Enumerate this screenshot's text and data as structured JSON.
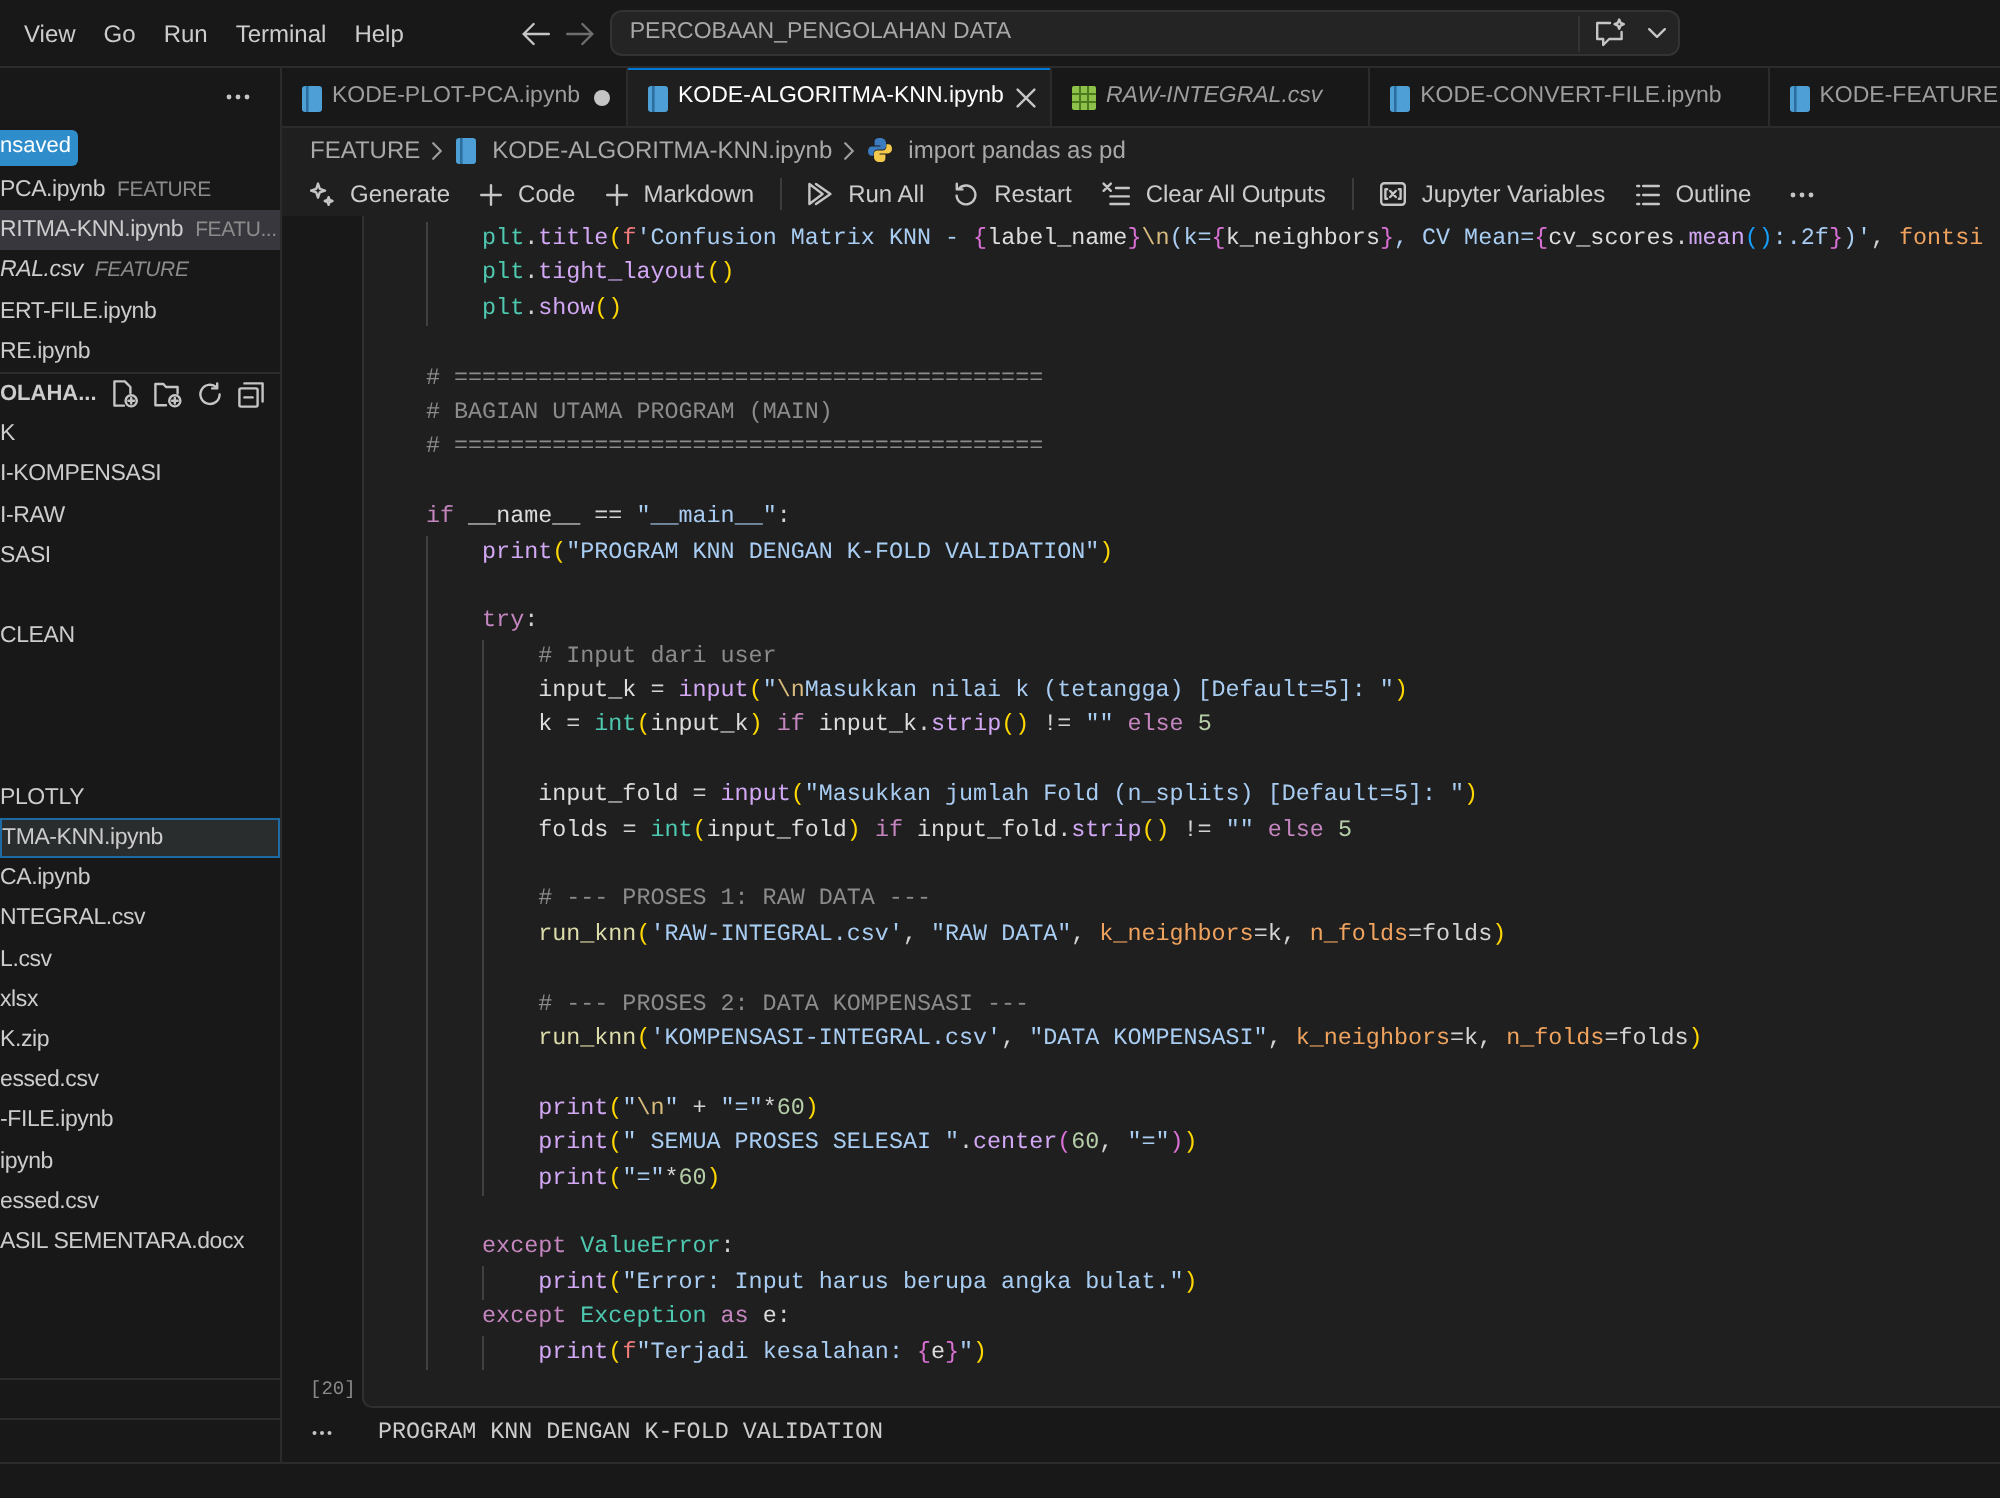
{
  "menu_bar": [
    "View",
    "Go",
    "Run",
    "Terminal",
    "Help"
  ],
  "command_center": {
    "text": "PERCOBAAN_PENGOLAHAN DATA"
  },
  "sidebar": {
    "unsaved_badge": "nsaved",
    "open_editors": [
      {
        "name": "PCA.ipynb",
        "description": "FEATURE",
        "selected": false,
        "preview": false
      },
      {
        "name": "RITMA-KNN.ipynb",
        "description": "FEATU...",
        "selected": true,
        "preview": false
      },
      {
        "name": "RAL.csv",
        "description": "FEATURE",
        "selected": false,
        "preview": true
      },
      {
        "name": "ERT-FILE.ipynb",
        "selected": false,
        "preview": false
      },
      {
        "name": "RE.ipynb",
        "selected": false,
        "preview": false
      }
    ],
    "explorer_title": "OLAHA...",
    "tree": [
      {
        "label": "K",
        "selected": false
      },
      {
        "label": "I-KOMPENSASI",
        "selected": false
      },
      {
        "label": "I-RAW",
        "selected": false
      },
      {
        "label": "SASI",
        "selected": false
      },
      {
        "label": "CLEAN",
        "selected": false
      },
      {
        "label": "PLOTLY",
        "selected": false
      },
      {
        "label": "TMA-KNN.ipynb",
        "selected": true
      },
      {
        "label": "CA.ipynb",
        "selected": false
      },
      {
        "label": "NTEGRAL.csv",
        "selected": false
      },
      {
        "label": "L.csv",
        "selected": false
      },
      {
        "label": "xlsx",
        "selected": false
      },
      {
        "label": "K.zip",
        "selected": false
      },
      {
        "label": "essed.csv",
        "selected": false
      },
      {
        "label": "-FILE.ipynb",
        "selected": false
      },
      {
        "label": "ipynb",
        "selected": false
      },
      {
        "label": "essed.csv",
        "selected": false
      },
      {
        "label": "ASIL SEMENTARA.docx",
        "selected": false
      }
    ]
  },
  "tabs": [
    {
      "label": "KODE-PLOT-PCA.ipynb",
      "kind": "notebook",
      "selected": false,
      "modified": true,
      "preview": false
    },
    {
      "label": "KODE-ALGORITMA-KNN.ipynb",
      "kind": "notebook",
      "selected": true,
      "modified": false,
      "preview": false
    },
    {
      "label": "RAW-INTEGRAL.csv",
      "kind": "csv",
      "selected": false,
      "modified": false,
      "preview": true
    },
    {
      "label": "KODE-CONVERT-FILE.ipynb",
      "kind": "notebook",
      "selected": false,
      "modified": false,
      "preview": false
    },
    {
      "label": "KODE-FEATURE",
      "kind": "notebook",
      "selected": false,
      "modified": false,
      "preview": false
    }
  ],
  "breadcrumb": [
    {
      "kind": "folder",
      "label": "FEATURE"
    },
    {
      "kind": "notebook",
      "label": "KODE-ALGORITMA-KNN.ipynb"
    },
    {
      "kind": "python",
      "label": "import pandas as pd"
    }
  ],
  "toolbar": {
    "groups": [
      [
        "Generate",
        "Code",
        "Markdown"
      ],
      [
        "Run All",
        "Restart",
        "Clear All Outputs"
      ],
      [
        "Jupyter Variables",
        "Outline"
      ]
    ]
  },
  "cell": {
    "execution_count": "[20]",
    "lines": [
      {
        "kind": "group",
        "children": [
          {
            "kind": "code",
            "tokens": [
              {
                "kind": "cls",
                "text": "plt"
              },
              {
                "kind": "op",
                "text": "."
              },
              {
                "kind": "fn",
                "text": "title"
              },
              {
                "kind": "br1",
                "text": "("
              },
              {
                "kind": "fpre",
                "text": "f"
              },
              {
                "kind": "str",
                "text": "'Confusion Matrix KNN - "
              },
              {
                "kind": "br2",
                "text": "{"
              },
              {
                "kind": "var",
                "text": "label_name"
              },
              {
                "kind": "br2",
                "text": "}"
              },
              {
                "kind": "esc",
                "text": "\\n"
              },
              {
                "kind": "str",
                "text": "(k="
              },
              {
                "kind": "br2",
                "text": "{"
              },
              {
                "kind": "var",
                "text": "k_neighbors"
              },
              {
                "kind": "br2",
                "text": "}"
              },
              {
                "kind": "str",
                "text": ", CV Mean="
              },
              {
                "kind": "br2",
                "text": "{"
              },
              {
                "kind": "var",
                "text": "cv_scores"
              },
              {
                "kind": "op",
                "text": "."
              },
              {
                "kind": "fn",
                "text": "mean"
              },
              {
                "kind": "br3",
                "text": "()"
              },
              {
                "kind": "str",
                "text": ":.2f"
              },
              {
                "kind": "br2",
                "text": "}"
              },
              {
                "kind": "str",
                "text": ")'"
              },
              {
                "kind": "op",
                "text": ", "
              },
              {
                "kind": "param",
                "text": "fontsi"
              }
            ]
          },
          {
            "kind": "code",
            "tokens": [
              {
                "kind": "cls",
                "text": "plt"
              },
              {
                "kind": "op",
                "text": "."
              },
              {
                "kind": "fn",
                "text": "tight_layout"
              },
              {
                "kind": "br1",
                "text": "()"
              }
            ]
          },
          {
            "kind": "code",
            "tokens": [
              {
                "kind": "cls",
                "text": "plt"
              },
              {
                "kind": "op",
                "text": "."
              },
              {
                "kind": "fn",
                "text": "show"
              },
              {
                "kind": "br1",
                "text": "()"
              }
            ]
          }
        ]
      },
      {
        "kind": "blank"
      },
      {
        "kind": "code",
        "tokens": [
          {
            "kind": "cmt",
            "text": "# =========================================="
          }
        ]
      },
      {
        "kind": "code",
        "tokens": [
          {
            "kind": "cmt",
            "text": "# BAGIAN UTAMA PROGRAM (MAIN)"
          }
        ]
      },
      {
        "kind": "code",
        "tokens": [
          {
            "kind": "cmt",
            "text": "# =========================================="
          }
        ]
      },
      {
        "kind": "blank"
      },
      {
        "kind": "code",
        "tokens": [
          {
            "kind": "kw",
            "text": "if"
          },
          {
            "kind": "var",
            "text": " __name__ "
          },
          {
            "kind": "op",
            "text": "== "
          },
          {
            "kind": "str",
            "text": "\"__main__\""
          },
          {
            "kind": "op",
            "text": ":"
          }
        ],
        "children": [
          {
            "kind": "code",
            "tokens": [
              {
                "kind": "fn",
                "text": "print"
              },
              {
                "kind": "br1",
                "text": "("
              },
              {
                "kind": "str",
                "text": "\"PROGRAM KNN DENGAN K-FOLD VALIDATION\""
              },
              {
                "kind": "br1",
                "text": ")"
              }
            ]
          },
          {
            "kind": "blank"
          },
          {
            "kind": "code",
            "tokens": [
              {
                "kind": "kw",
                "text": "try"
              },
              {
                "kind": "op",
                "text": ":"
              }
            ],
            "children": [
              {
                "kind": "code",
                "tokens": [
                  {
                    "kind": "cmt",
                    "text": "# Input dari user"
                  }
                ]
              },
              {
                "kind": "code",
                "tokens": [
                  {
                    "kind": "var",
                    "text": "input_k "
                  },
                  {
                    "kind": "op",
                    "text": "= "
                  },
                  {
                    "kind": "fn",
                    "text": "input"
                  },
                  {
                    "kind": "br1",
                    "text": "("
                  },
                  {
                    "kind": "str",
                    "text": "\""
                  },
                  {
                    "kind": "esc",
                    "text": "\\n"
                  },
                  {
                    "kind": "str",
                    "text": "Masukkan nilai k (tetangga) [Default=5]: \""
                  },
                  {
                    "kind": "br1",
                    "text": ")"
                  }
                ]
              },
              {
                "kind": "code",
                "tokens": [
                  {
                    "kind": "var",
                    "text": "k "
                  },
                  {
                    "kind": "op",
                    "text": "= "
                  },
                  {
                    "kind": "cls",
                    "text": "int"
                  },
                  {
                    "kind": "br1",
                    "text": "("
                  },
                  {
                    "kind": "var",
                    "text": "input_k"
                  },
                  {
                    "kind": "br1",
                    "text": ")"
                  },
                  {
                    "kind": "kw",
                    "text": " if "
                  },
                  {
                    "kind": "var",
                    "text": "input_k"
                  },
                  {
                    "kind": "op",
                    "text": "."
                  },
                  {
                    "kind": "fn",
                    "text": "strip"
                  },
                  {
                    "kind": "br1",
                    "text": "()"
                  },
                  {
                    "kind": "op",
                    "text": " != "
                  },
                  {
                    "kind": "str",
                    "text": "\"\""
                  },
                  {
                    "kind": "kw",
                    "text": " else "
                  },
                  {
                    "kind": "num",
                    "text": "5"
                  }
                ]
              },
              {
                "kind": "blank"
              },
              {
                "kind": "code",
                "tokens": [
                  {
                    "kind": "var",
                    "text": "input_fold "
                  },
                  {
                    "kind": "op",
                    "text": "= "
                  },
                  {
                    "kind": "fn",
                    "text": "input"
                  },
                  {
                    "kind": "br1",
                    "text": "("
                  },
                  {
                    "kind": "str",
                    "text": "\"Masukkan jumlah Fold (n_splits) [Default=5]: \""
                  },
                  {
                    "kind": "br1",
                    "text": ")"
                  }
                ]
              },
              {
                "kind": "code",
                "tokens": [
                  {
                    "kind": "var",
                    "text": "folds "
                  },
                  {
                    "kind": "op",
                    "text": "= "
                  },
                  {
                    "kind": "cls",
                    "text": "int"
                  },
                  {
                    "kind": "br1",
                    "text": "("
                  },
                  {
                    "kind": "var",
                    "text": "input_fold"
                  },
                  {
                    "kind": "br1",
                    "text": ")"
                  },
                  {
                    "kind": "kw",
                    "text": " if "
                  },
                  {
                    "kind": "var",
                    "text": "input_fold"
                  },
                  {
                    "kind": "op",
                    "text": "."
                  },
                  {
                    "kind": "fn",
                    "text": "strip"
                  },
                  {
                    "kind": "br1",
                    "text": "()"
                  },
                  {
                    "kind": "op",
                    "text": " != "
                  },
                  {
                    "kind": "str",
                    "text": "\"\""
                  },
                  {
                    "kind": "kw",
                    "text": " else "
                  },
                  {
                    "kind": "num",
                    "text": "5"
                  }
                ]
              },
              {
                "kind": "blank"
              },
              {
                "kind": "code",
                "tokens": [
                  {
                    "kind": "cmt",
                    "text": "# --- PROSES 1: RAW DATA ---"
                  }
                ]
              },
              {
                "kind": "code",
                "tokens": [
                  {
                    "kind": "ufn",
                    "text": "run_knn"
                  },
                  {
                    "kind": "br1",
                    "text": "("
                  },
                  {
                    "kind": "str",
                    "text": "'RAW-INTEGRAL.csv'"
                  },
                  {
                    "kind": "op",
                    "text": ", "
                  },
                  {
                    "kind": "str",
                    "text": "\"RAW DATA\""
                  },
                  {
                    "kind": "op",
                    "text": ", "
                  },
                  {
                    "kind": "param",
                    "text": "k_neighbors"
                  },
                  {
                    "kind": "op",
                    "text": "=k, "
                  },
                  {
                    "kind": "param",
                    "text": "n_folds"
                  },
                  {
                    "kind": "op",
                    "text": "=folds"
                  },
                  {
                    "kind": "br1",
                    "text": ")"
                  }
                ]
              },
              {
                "kind": "blank"
              },
              {
                "kind": "code",
                "tokens": [
                  {
                    "kind": "cmt",
                    "text": "# --- PROSES 2: DATA KOMPENSASI ---"
                  }
                ]
              },
              {
                "kind": "code",
                "tokens": [
                  {
                    "kind": "ufn",
                    "text": "run_knn"
                  },
                  {
                    "kind": "br1",
                    "text": "("
                  },
                  {
                    "kind": "str",
                    "text": "'KOMPENSASI-INTEGRAL.csv'"
                  },
                  {
                    "kind": "op",
                    "text": ", "
                  },
                  {
                    "kind": "str",
                    "text": "\"DATA KOMPENSASI\""
                  },
                  {
                    "kind": "op",
                    "text": ", "
                  },
                  {
                    "kind": "param",
                    "text": "k_neighbors"
                  },
                  {
                    "kind": "op",
                    "text": "=k, "
                  },
                  {
                    "kind": "param",
                    "text": "n_folds"
                  },
                  {
                    "kind": "op",
                    "text": "=folds"
                  },
                  {
                    "kind": "br1",
                    "text": ")"
                  }
                ]
              },
              {
                "kind": "blank"
              },
              {
                "kind": "code",
                "tokens": [
                  {
                    "kind": "fn",
                    "text": "print"
                  },
                  {
                    "kind": "br1",
                    "text": "("
                  },
                  {
                    "kind": "str",
                    "text": "\""
                  },
                  {
                    "kind": "esc",
                    "text": "\\n"
                  },
                  {
                    "kind": "str",
                    "text": "\""
                  },
                  {
                    "kind": "op",
                    "text": " + "
                  },
                  {
                    "kind": "str",
                    "text": "\"=\""
                  },
                  {
                    "kind": "op",
                    "text": "*"
                  },
                  {
                    "kind": "num",
                    "text": "60"
                  },
                  {
                    "kind": "br1",
                    "text": ")"
                  }
                ]
              },
              {
                "kind": "code",
                "tokens": [
                  {
                    "kind": "fn",
                    "text": "print"
                  },
                  {
                    "kind": "br1",
                    "text": "("
                  },
                  {
                    "kind": "str",
                    "text": "\" SEMUA PROSES SELESAI \""
                  },
                  {
                    "kind": "op",
                    "text": "."
                  },
                  {
                    "kind": "fn",
                    "text": "center"
                  },
                  {
                    "kind": "br2",
                    "text": "("
                  },
                  {
                    "kind": "num",
                    "text": "60"
                  },
                  {
                    "kind": "op",
                    "text": ", "
                  },
                  {
                    "kind": "str",
                    "text": "\"=\""
                  },
                  {
                    "kind": "br2",
                    "text": ")"
                  },
                  {
                    "kind": "br1",
                    "text": ")"
                  }
                ]
              },
              {
                "kind": "code",
                "tokens": [
                  {
                    "kind": "fn",
                    "text": "print"
                  },
                  {
                    "kind": "br1",
                    "text": "("
                  },
                  {
                    "kind": "str",
                    "text": "\"=\""
                  },
                  {
                    "kind": "op",
                    "text": "*"
                  },
                  {
                    "kind": "num",
                    "text": "60"
                  },
                  {
                    "kind": "br1",
                    "text": ")"
                  }
                ]
              }
            ]
          },
          {
            "kind": "blank"
          },
          {
            "kind": "code",
            "tokens": [
              {
                "kind": "kw",
                "text": "except"
              },
              {
                "kind": "cls",
                "text": " ValueError"
              },
              {
                "kind": "op",
                "text": ":"
              }
            ],
            "children": [
              {
                "kind": "code",
                "tokens": [
                  {
                    "kind": "fn",
                    "text": "print"
                  },
                  {
                    "kind": "br1",
                    "text": "("
                  },
                  {
                    "kind": "str",
                    "text": "\"Error: Input harus berupa angka bulat.\""
                  },
                  {
                    "kind": "br1",
                    "text": ")"
                  }
                ]
              }
            ]
          },
          {
            "kind": "code",
            "tokens": [
              {
                "kind": "kw",
                "text": "except"
              },
              {
                "kind": "cls",
                "text": " Exception"
              },
              {
                "kind": "kw",
                "text": " as"
              },
              {
                "kind": "var",
                "text": " e"
              },
              {
                "kind": "op",
                "text": ":"
              }
            ],
            "children": [
              {
                "kind": "code",
                "tokens": [
                  {
                    "kind": "fn",
                    "text": "print"
                  },
                  {
                    "kind": "br1",
                    "text": "("
                  },
                  {
                    "kind": "fpre",
                    "text": "f"
                  },
                  {
                    "kind": "str",
                    "text": "\"Terjadi kesalahan: "
                  },
                  {
                    "kind": "br2",
                    "text": "{"
                  },
                  {
                    "kind": "var",
                    "text": "e"
                  },
                  {
                    "kind": "br2",
                    "text": "}"
                  },
                  {
                    "kind": "str",
                    "text": "\""
                  },
                  {
                    "kind": "br1",
                    "text": ")"
                  }
                ]
              }
            ]
          }
        ]
      }
    ]
  },
  "output": {
    "lines": [
      "PROGRAM KNN DENGAN K-FOLD VALIDATION"
    ]
  }
}
